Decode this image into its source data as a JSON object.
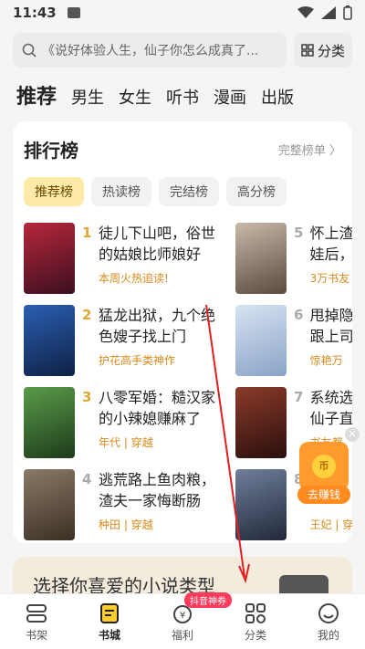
{
  "status": {
    "time": "11:43"
  },
  "search": {
    "placeholder": "《说好体验人生，仙子你怎么成真了...",
    "category_label": "分类"
  },
  "top_tabs": [
    "推荐",
    "男生",
    "女生",
    "听书",
    "漫画",
    "出版"
  ],
  "ranking": {
    "title": "排行榜",
    "more": "完整榜单 〉",
    "tabs": [
      "推荐榜",
      "热读榜",
      "完结榜",
      "高分榜"
    ],
    "books": [
      {
        "rank": "1",
        "title": "徒儿下山吧，俗世的姑娘比师娘好",
        "sub": "本周火热追读!",
        "cover": [
          "#b8263b",
          "#3b1020"
        ]
      },
      {
        "rank": "2",
        "title": "猛龙出狱，九个绝色嫂子找上门",
        "sub": "护花高手类神作",
        "cover": [
          "#2b5fb3",
          "#0e2144"
        ]
      },
      {
        "rank": "3",
        "title": "八零军婚：糙汉家的小辣媳赚麻了",
        "sub": "年代 | 穿越",
        "cover": [
          "#5a9b4a",
          "#1d3b1a"
        ]
      },
      {
        "rank": "4",
        "title": "逃荒路上鱼肉粮，渣夫一家悔断肠",
        "sub": "种田 | 穿越",
        "cover": [
          "#8a7a66",
          "#3b2f25"
        ]
      },
      {
        "rank": "5",
        "title": "怀上渣男...娃后，...",
        "sub": "3万书友",
        "cover": [
          "#c9b9a8",
          "#5a4a40"
        ]
      },
      {
        "rank": "6",
        "title": "甩掉隐...跟上司...",
        "sub": "惊艳万",
        "cover": [
          "#d7e3f2",
          "#8aa3c7"
        ]
      },
      {
        "rank": "7",
        "title": "系统选...仙子直...",
        "sub": "书友都",
        "cover": [
          "#8b3b2a",
          "#2a0f0c"
        ]
      },
      {
        "rank": "8",
        "title": "...",
        "sub": "王妃 | 穿",
        "cover": [
          "#6f7f9a",
          "#22283a"
        ]
      }
    ]
  },
  "right_column_text": {
    "b5_line1": "怀上渣",
    "b5_line2": "娃后，",
    "b6_line1": "甩掉隐",
    "b6_line2": "跟上司",
    "b7_line1": "系统选",
    "b7_line2": "仙子直"
  },
  "float_reward": {
    "label": "去赚钱",
    "coin": "币"
  },
  "banner": {
    "text": "选择你喜爱的小说类型"
  },
  "bottom_nav": [
    {
      "label": "书架",
      "active": false
    },
    {
      "label": "书城",
      "active": true
    },
    {
      "label": "福利",
      "active": false,
      "badge": "抖音神券"
    },
    {
      "label": "分类",
      "active": false
    },
    {
      "label": "我的",
      "active": false
    }
  ]
}
